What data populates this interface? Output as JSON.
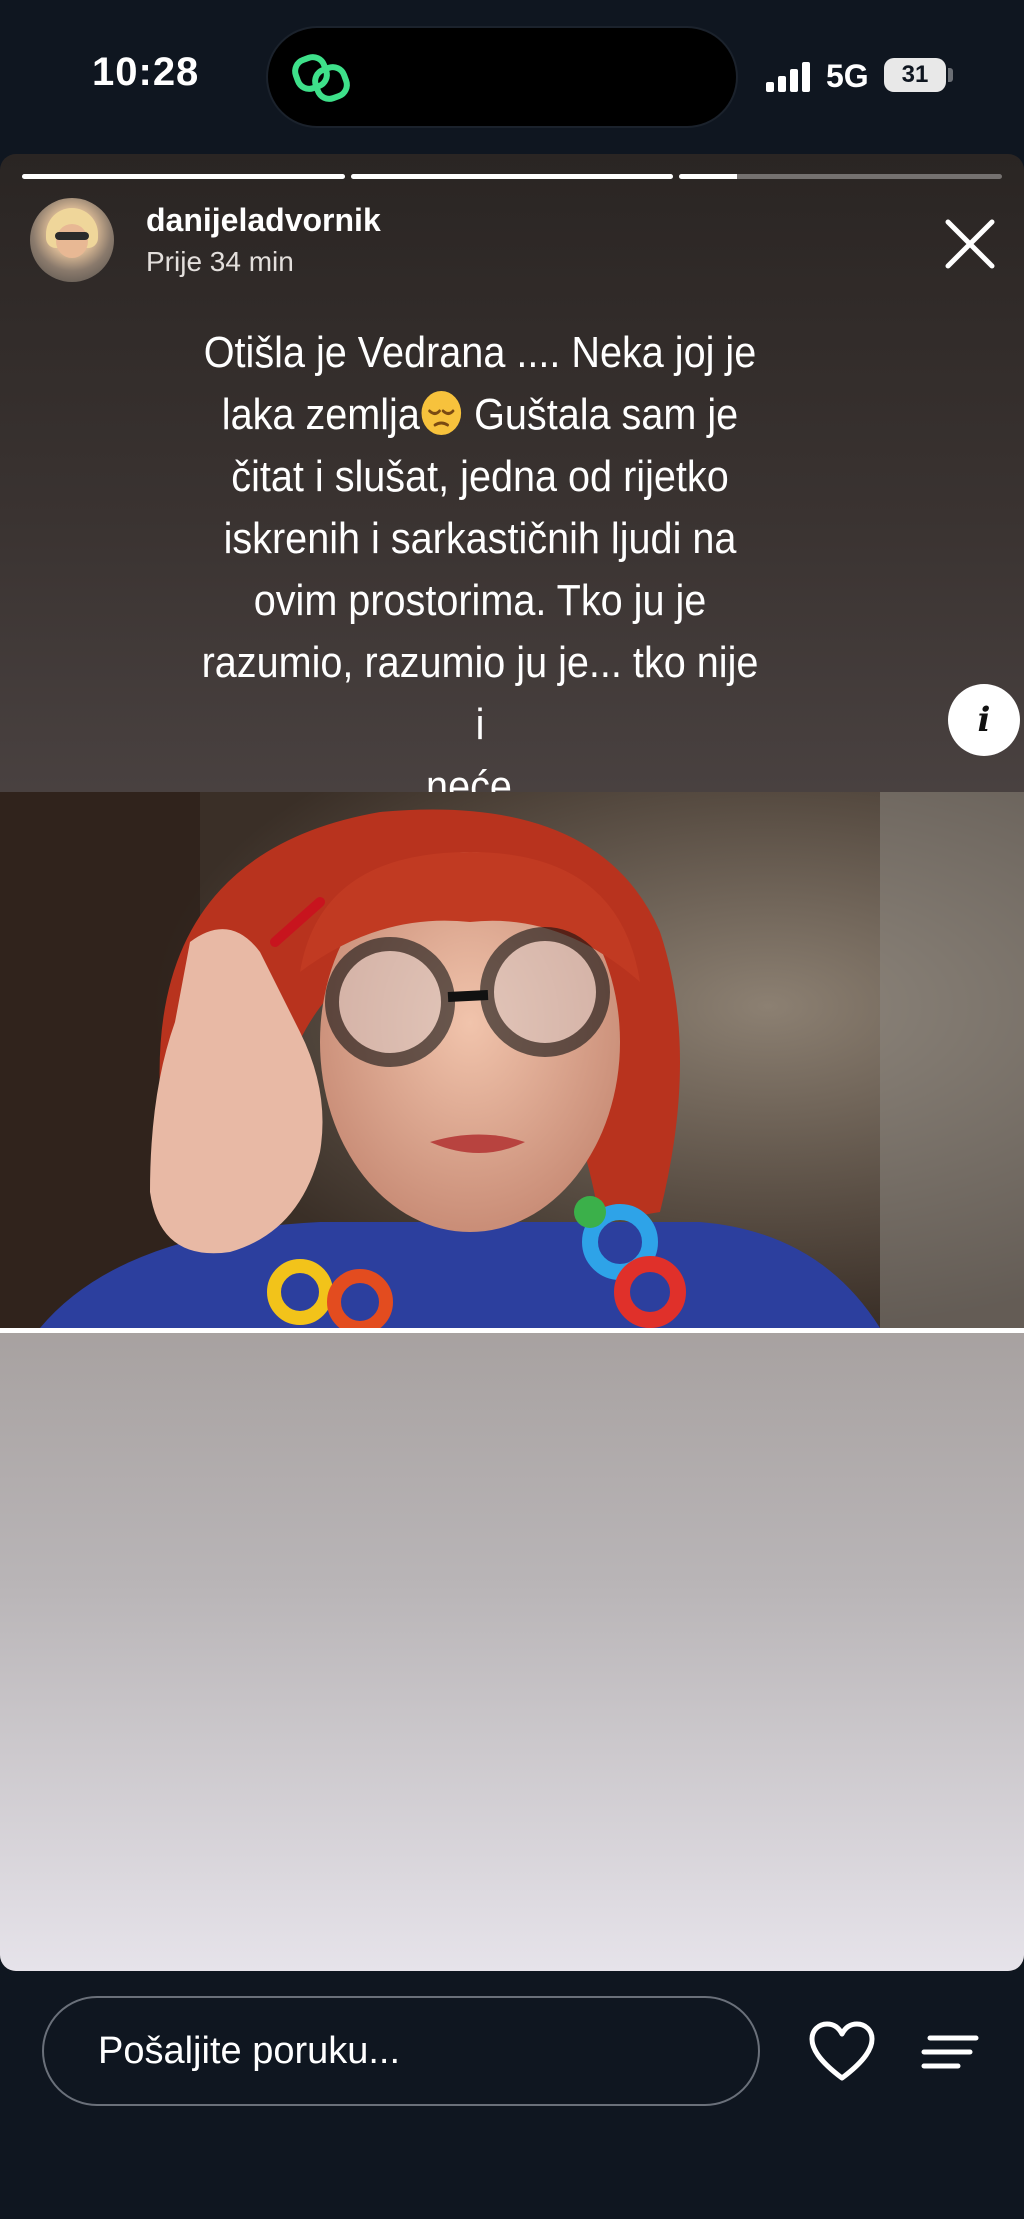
{
  "status_bar": {
    "time": "10:28",
    "network": "5G",
    "battery": "31",
    "island_icon": "link-chain-icon"
  },
  "story": {
    "progress": [
      1.0,
      1.0,
      0.18
    ],
    "username": "danijeladvornik",
    "time_ago": "Prije 34 min",
    "caption_lines": [
      "Otišla je Vedrana .... Neka joj je",
      "laka zemlja",
      " Guštala sam je",
      "čitat i slušat, jedna od rijetko",
      "iskrenih i sarkastičnih ljudi na",
      "ovim prostorima. Tko ju je",
      "razumio, razumio ju je... tko nije i",
      "neće ."
    ],
    "emoji": "pensive-face-emoji",
    "info_label": "i",
    "close_icon": "close-icon"
  },
  "bottom_bar": {
    "message_placeholder": "Pošaljite poruku...",
    "like_icon": "heart-icon",
    "menu_icon": "menu-lines-icon"
  },
  "colors": {
    "background": "#0f1620",
    "island_accent": "#3ee08a",
    "text": "#ffffff"
  }
}
